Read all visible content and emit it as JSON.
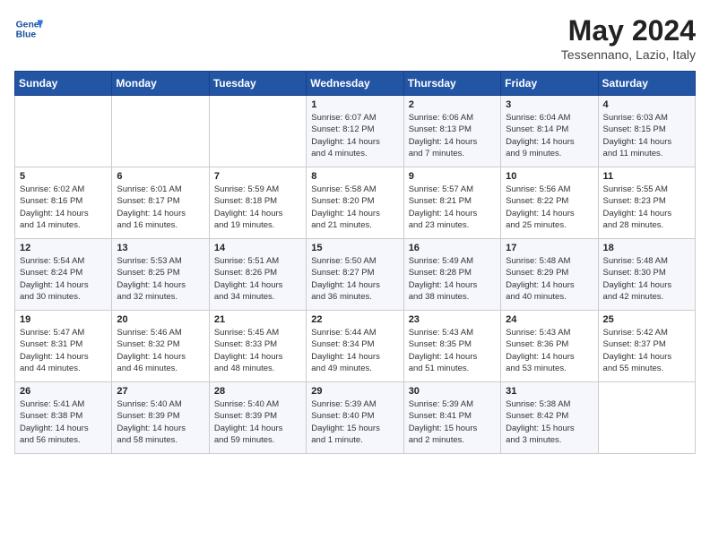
{
  "header": {
    "logo_line1": "General",
    "logo_line2": "Blue",
    "month_year": "May 2024",
    "location": "Tessennano, Lazio, Italy"
  },
  "days_of_week": [
    "Sunday",
    "Monday",
    "Tuesday",
    "Wednesday",
    "Thursday",
    "Friday",
    "Saturday"
  ],
  "weeks": [
    [
      {
        "day": "",
        "info": ""
      },
      {
        "day": "",
        "info": ""
      },
      {
        "day": "",
        "info": ""
      },
      {
        "day": "1",
        "info": "Sunrise: 6:07 AM\nSunset: 8:12 PM\nDaylight: 14 hours\nand 4 minutes."
      },
      {
        "day": "2",
        "info": "Sunrise: 6:06 AM\nSunset: 8:13 PM\nDaylight: 14 hours\nand 7 minutes."
      },
      {
        "day": "3",
        "info": "Sunrise: 6:04 AM\nSunset: 8:14 PM\nDaylight: 14 hours\nand 9 minutes."
      },
      {
        "day": "4",
        "info": "Sunrise: 6:03 AM\nSunset: 8:15 PM\nDaylight: 14 hours\nand 11 minutes."
      }
    ],
    [
      {
        "day": "5",
        "info": "Sunrise: 6:02 AM\nSunset: 8:16 PM\nDaylight: 14 hours\nand 14 minutes."
      },
      {
        "day": "6",
        "info": "Sunrise: 6:01 AM\nSunset: 8:17 PM\nDaylight: 14 hours\nand 16 minutes."
      },
      {
        "day": "7",
        "info": "Sunrise: 5:59 AM\nSunset: 8:18 PM\nDaylight: 14 hours\nand 19 minutes."
      },
      {
        "day": "8",
        "info": "Sunrise: 5:58 AM\nSunset: 8:20 PM\nDaylight: 14 hours\nand 21 minutes."
      },
      {
        "day": "9",
        "info": "Sunrise: 5:57 AM\nSunset: 8:21 PM\nDaylight: 14 hours\nand 23 minutes."
      },
      {
        "day": "10",
        "info": "Sunrise: 5:56 AM\nSunset: 8:22 PM\nDaylight: 14 hours\nand 25 minutes."
      },
      {
        "day": "11",
        "info": "Sunrise: 5:55 AM\nSunset: 8:23 PM\nDaylight: 14 hours\nand 28 minutes."
      }
    ],
    [
      {
        "day": "12",
        "info": "Sunrise: 5:54 AM\nSunset: 8:24 PM\nDaylight: 14 hours\nand 30 minutes."
      },
      {
        "day": "13",
        "info": "Sunrise: 5:53 AM\nSunset: 8:25 PM\nDaylight: 14 hours\nand 32 minutes."
      },
      {
        "day": "14",
        "info": "Sunrise: 5:51 AM\nSunset: 8:26 PM\nDaylight: 14 hours\nand 34 minutes."
      },
      {
        "day": "15",
        "info": "Sunrise: 5:50 AM\nSunset: 8:27 PM\nDaylight: 14 hours\nand 36 minutes."
      },
      {
        "day": "16",
        "info": "Sunrise: 5:49 AM\nSunset: 8:28 PM\nDaylight: 14 hours\nand 38 minutes."
      },
      {
        "day": "17",
        "info": "Sunrise: 5:48 AM\nSunset: 8:29 PM\nDaylight: 14 hours\nand 40 minutes."
      },
      {
        "day": "18",
        "info": "Sunrise: 5:48 AM\nSunset: 8:30 PM\nDaylight: 14 hours\nand 42 minutes."
      }
    ],
    [
      {
        "day": "19",
        "info": "Sunrise: 5:47 AM\nSunset: 8:31 PM\nDaylight: 14 hours\nand 44 minutes."
      },
      {
        "day": "20",
        "info": "Sunrise: 5:46 AM\nSunset: 8:32 PM\nDaylight: 14 hours\nand 46 minutes."
      },
      {
        "day": "21",
        "info": "Sunrise: 5:45 AM\nSunset: 8:33 PM\nDaylight: 14 hours\nand 48 minutes."
      },
      {
        "day": "22",
        "info": "Sunrise: 5:44 AM\nSunset: 8:34 PM\nDaylight: 14 hours\nand 49 minutes."
      },
      {
        "day": "23",
        "info": "Sunrise: 5:43 AM\nSunset: 8:35 PM\nDaylight: 14 hours\nand 51 minutes."
      },
      {
        "day": "24",
        "info": "Sunrise: 5:43 AM\nSunset: 8:36 PM\nDaylight: 14 hours\nand 53 minutes."
      },
      {
        "day": "25",
        "info": "Sunrise: 5:42 AM\nSunset: 8:37 PM\nDaylight: 14 hours\nand 55 minutes."
      }
    ],
    [
      {
        "day": "26",
        "info": "Sunrise: 5:41 AM\nSunset: 8:38 PM\nDaylight: 14 hours\nand 56 minutes."
      },
      {
        "day": "27",
        "info": "Sunrise: 5:40 AM\nSunset: 8:39 PM\nDaylight: 14 hours\nand 58 minutes."
      },
      {
        "day": "28",
        "info": "Sunrise: 5:40 AM\nSunset: 8:39 PM\nDaylight: 14 hours\nand 59 minutes."
      },
      {
        "day": "29",
        "info": "Sunrise: 5:39 AM\nSunset: 8:40 PM\nDaylight: 15 hours\nand 1 minute."
      },
      {
        "day": "30",
        "info": "Sunrise: 5:39 AM\nSunset: 8:41 PM\nDaylight: 15 hours\nand 2 minutes."
      },
      {
        "day": "31",
        "info": "Sunrise: 5:38 AM\nSunset: 8:42 PM\nDaylight: 15 hours\nand 3 minutes."
      },
      {
        "day": "",
        "info": ""
      }
    ]
  ]
}
